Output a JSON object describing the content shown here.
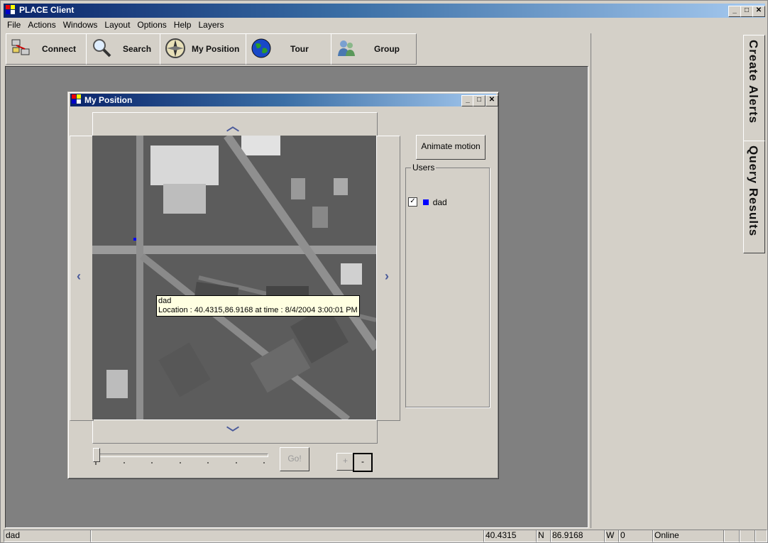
{
  "app": {
    "title": "PLACE Client"
  },
  "menu": [
    "File",
    "Actions",
    "Windows",
    "Layout",
    "Options",
    "Help",
    "Layers"
  ],
  "toolbar": [
    {
      "label": "Connect",
      "icon": "network-computers-icon"
    },
    {
      "label": "Search",
      "icon": "magnifier-icon"
    },
    {
      "label": "My Position",
      "icon": "compass-icon"
    },
    {
      "label": "Tour",
      "icon": "globe-icon"
    },
    {
      "label": "Group",
      "icon": "people-icon"
    }
  ],
  "side_tabs": [
    "Create Alerts",
    "Query Results"
  ],
  "child": {
    "title": "My Position",
    "tooltip": {
      "user": "dad",
      "location": "Location : 40.4315,86.9168 at time : 8/4/2004 3:00:01 PM"
    },
    "animate_label": "Animate motion",
    "users_label": "Users",
    "users": [
      {
        "name": "dad",
        "checked": true,
        "color": "#0000ff"
      }
    ],
    "go_label": "Go!",
    "zoom_in_label": "+",
    "zoom_out_label": "-",
    "slider_value": 0
  },
  "status": {
    "user": "dad",
    "lat": "40.4315",
    "lat_dir": "N",
    "lon": "86.9168",
    "lon_dir": "W",
    "count": "0",
    "state": "Online"
  },
  "colors": {
    "titlebar_start": "#0a246a",
    "titlebar_end": "#a6caf0",
    "workspace": "#808080",
    "face": "#d4d0c8"
  }
}
